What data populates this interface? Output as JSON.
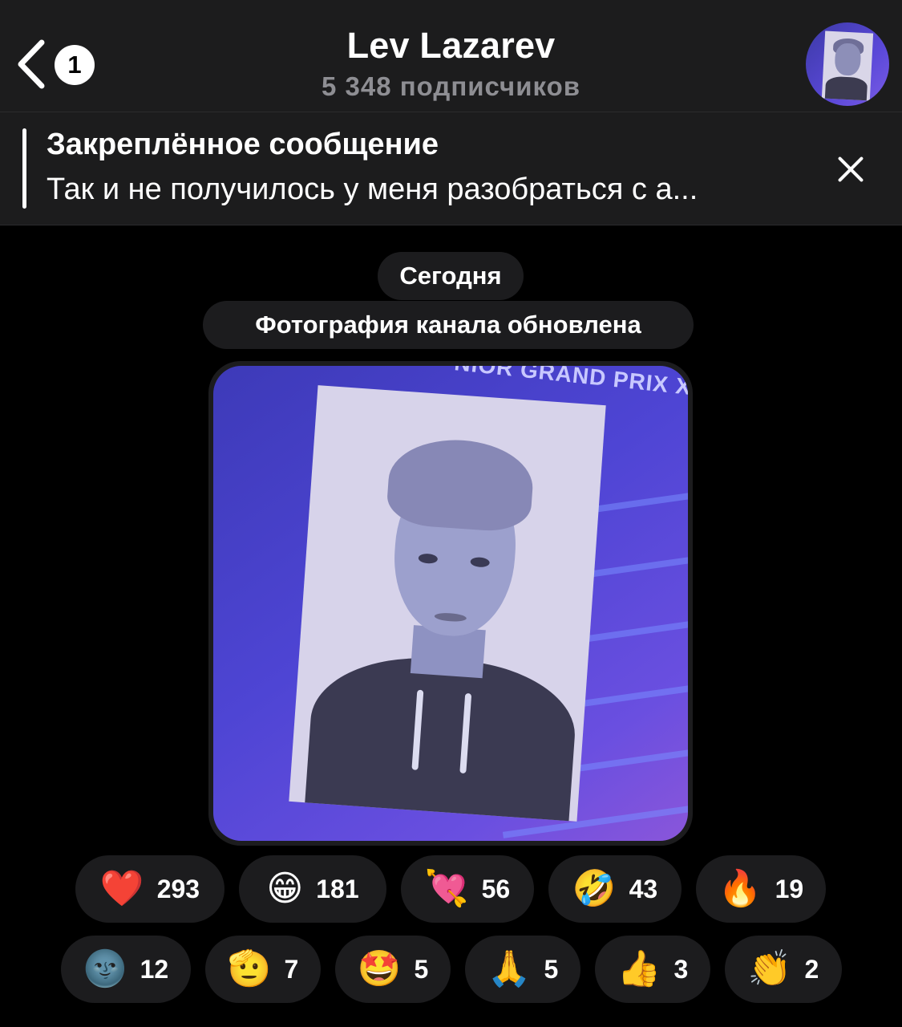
{
  "header": {
    "back_count": "1",
    "title": "Lev Lazarev",
    "subtitle": "5 348 подписчиков"
  },
  "pinned": {
    "title": "Закреплённое сообщение",
    "text": "Так и не получилось у меня разобраться с а..."
  },
  "chat": {
    "date_label": "Сегодня",
    "service_message": "Фотография канала обновлена",
    "photo_banner_text": "NIOR GRAND PRIX XI"
  },
  "reactions": [
    {
      "emoji": "❤️",
      "icon": "red-heart-icon",
      "count": "293"
    },
    {
      "emoji": "😁",
      "icon": "grinning-face-icon",
      "count": "181"
    },
    {
      "emoji": "💘",
      "icon": "heart-with-arrow-icon",
      "count": "56"
    },
    {
      "emoji": "🤣",
      "icon": "rofl-face-icon",
      "count": "43"
    },
    {
      "emoji": "🔥",
      "icon": "fire-icon",
      "count": "19"
    },
    {
      "emoji": "🌚",
      "icon": "new-moon-face-icon",
      "count": "12"
    },
    {
      "emoji": "🫡",
      "icon": "saluting-face-icon",
      "count": "7"
    },
    {
      "emoji": "🤩",
      "icon": "star-struck-icon",
      "count": "5"
    },
    {
      "emoji": "🙏",
      "icon": "folded-hands-icon",
      "count": "5"
    },
    {
      "emoji": "👍",
      "icon": "thumbs-up-icon",
      "count": "3"
    },
    {
      "emoji": "👏",
      "icon": "clapping-hands-icon",
      "count": "2"
    }
  ]
}
